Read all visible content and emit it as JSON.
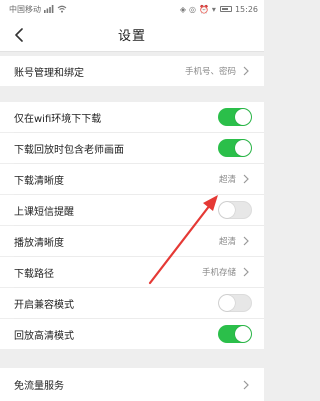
{
  "status_bar": {
    "carrier": "中国移动",
    "time": "15:26"
  },
  "header": {
    "title": "设置"
  },
  "settings": {
    "account": {
      "label": "账号管理和绑定",
      "value": "手机号、密码"
    },
    "wifi_only": {
      "label": "仅在wifi环境下下载",
      "state": true
    },
    "include_teacher": {
      "label": "下载回放时包含老师画面",
      "state": true
    },
    "download_quality": {
      "label": "下载清晰度",
      "value": "超清"
    },
    "sms_reminder": {
      "label": "上课短信提醒",
      "state": false
    },
    "play_quality": {
      "label": "播放清晰度",
      "value": "超清"
    },
    "download_path": {
      "label": "下载路径",
      "value": "手机存储"
    },
    "compat_mode": {
      "label": "开启兼容模式",
      "state": false
    },
    "hd_replay": {
      "label": "回放高清模式",
      "state": true
    },
    "free_data": {
      "label": "免流量服务"
    }
  },
  "colors": {
    "toggle_on": "#2bbf4a",
    "toggle_off": "#e7e7e7",
    "annotation_arrow": "#e53935"
  }
}
